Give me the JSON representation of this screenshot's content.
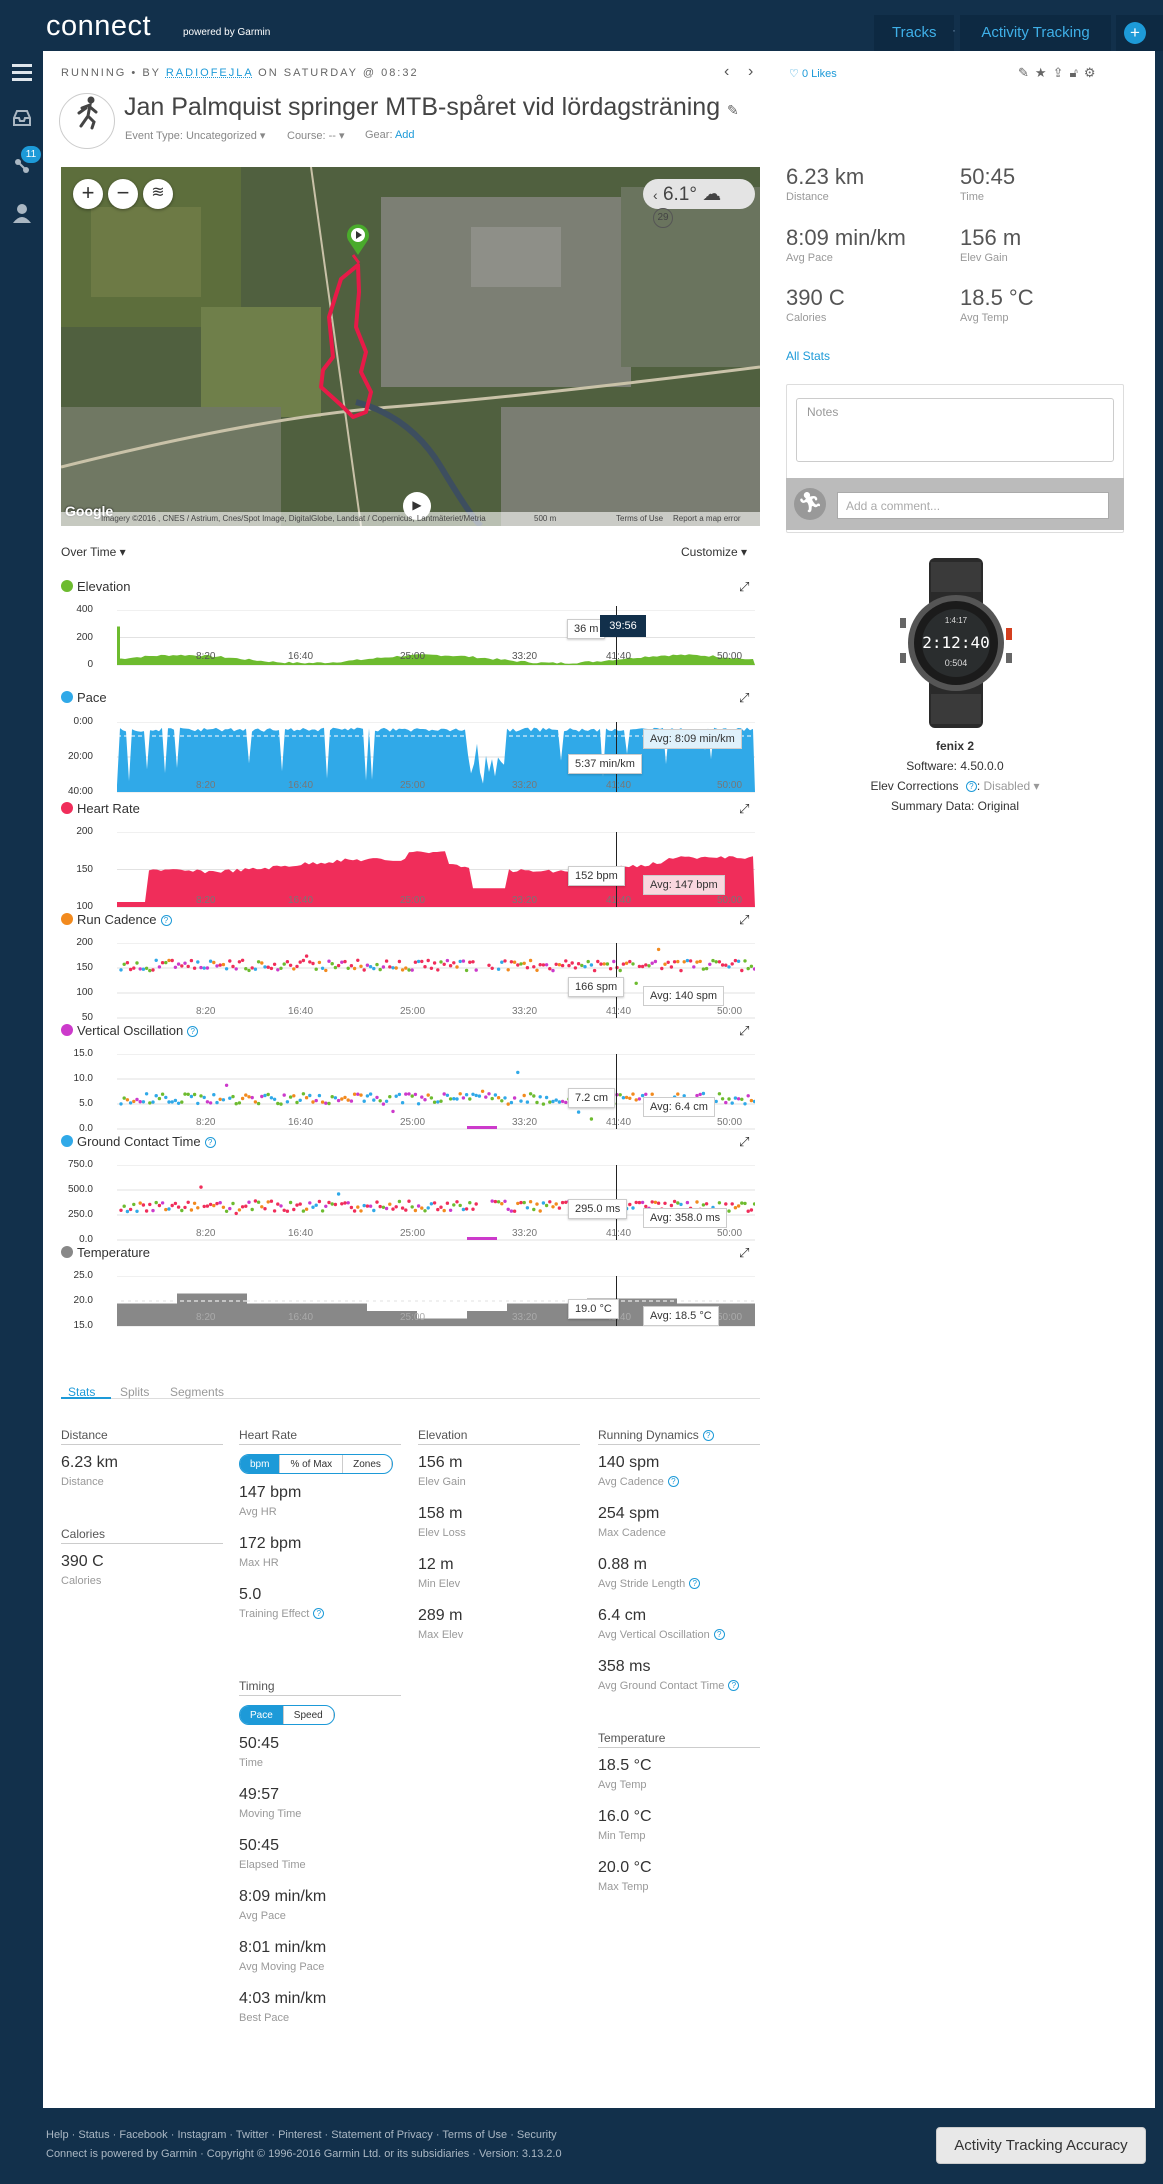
{
  "brand": {
    "logo": "connect",
    "sub": "powered by Garmin"
  },
  "topnav": {
    "tracks": "Tracks",
    "activity_tracking": "Activity Tracking",
    "plus": "+"
  },
  "sidebar": {
    "badge": "11"
  },
  "crumb": {
    "type": "RUNNING",
    "by": "BY",
    "user": "RADIOFEJLA",
    "on": "ON SATURDAY @ 08:32"
  },
  "likes": "0 Likes",
  "title": "Jan Palmquist springer MTB-spåret vid lördagsträning",
  "event": {
    "event_type": "Event Type: Uncategorized ▾",
    "course": "Course: -- ▾",
    "gear_label": "Gear:",
    "gear_add": "Add"
  },
  "map": {
    "temp": "6.1°",
    "wind": "29",
    "attribution": "Imagery ©2016 , CNES / Astrium, Cnes/Spot Image, DigitalGlobe, Landsat / Copernicus, Lantmäteriet/Metria",
    "scale": "500 m",
    "terms": "Terms of Use",
    "report": "Report a map error",
    "google": "Google"
  },
  "summary": [
    {
      "value": "6.23 km",
      "label": "Distance"
    },
    {
      "value": "50:45",
      "label": "Time"
    },
    {
      "value": "8:09 min/km",
      "label": "Avg Pace"
    },
    {
      "value": "156 m",
      "label": "Elev Gain"
    },
    {
      "value": "390 C",
      "label": "Calories"
    },
    {
      "value": "18.5 °C",
      "label": "Avg Temp"
    }
  ],
  "all_stats": "All Stats",
  "notes_placeholder": "Notes",
  "comment_placeholder": "Add a comment...",
  "device": {
    "name": "fenix 2",
    "software": "Software: 4.50.0.0",
    "elev_label": "Elev Corrections",
    "elev_value": "Disabled ▾",
    "summary": "Summary Data: Original",
    "face_time": "2:12:40",
    "face_top": "1:4:17",
    "face_bottom": "0:504"
  },
  "controls": {
    "over_time": "Over Time ▾",
    "customize": "Customize ▾"
  },
  "charts": {
    "cursor_time": "39:56",
    "x_ticks": [
      "8:20",
      "16:40",
      "25:00",
      "33:20",
      "41:40",
      "50:00"
    ],
    "elevation": {
      "title": "Elevation",
      "color": "#6dbb2f",
      "y": [
        "400",
        "200",
        "0"
      ],
      "callout": "36 m"
    },
    "pace": {
      "title": "Pace",
      "color": "#30a9e8",
      "y": [
        "0:00",
        "20:00",
        "40:00"
      ],
      "callout": "5:37 min/km",
      "avg": "Avg: 8:09 min/km"
    },
    "heart": {
      "title": "Heart Rate",
      "color": "#f02d5a",
      "y": [
        "200",
        "150",
        "100"
      ],
      "callout": "152 bpm",
      "avg": "Avg: 147 bpm"
    },
    "cadence": {
      "title": "Run Cadence",
      "color": "#f28a1e",
      "y": [
        "200",
        "150",
        "100",
        "50"
      ],
      "callout": "166 spm",
      "avg": "Avg: 140 spm"
    },
    "vo": {
      "title": "Vertical Oscillation",
      "color": "#cc3acb",
      "y": [
        "15.0",
        "10.0",
        "5.0",
        "0.0"
      ],
      "callout": "7.2 cm",
      "avg": "Avg: 6.4 cm"
    },
    "gct": {
      "title": "Ground Contact Time",
      "color": "#30a9e8",
      "y": [
        "750.0",
        "500.0",
        "250.0",
        "0.0"
      ],
      "callout": "295.0 ms",
      "avg": "Avg: 358.0 ms"
    },
    "temp": {
      "title": "Temperature",
      "color": "#888888",
      "y": [
        "25.0",
        "20.0",
        "15.0"
      ],
      "callout": "19.0 °C",
      "avg": "Avg: 18.5 °C"
    }
  },
  "tabs": [
    "Stats",
    "Splits",
    "Segments"
  ],
  "stats": {
    "distance": {
      "title": "Distance",
      "items": [
        {
          "v": "6.23 km",
          "l": "Distance"
        }
      ]
    },
    "calories": {
      "title": "Calories",
      "items": [
        {
          "v": "390 C",
          "l": "Calories"
        }
      ]
    },
    "heart": {
      "title": "Heart Rate",
      "toggle": [
        "bpm",
        "% of Max",
        "Zones"
      ],
      "items": [
        {
          "v": "147 bpm",
          "l": "Avg HR"
        },
        {
          "v": "172 bpm",
          "l": "Max HR"
        },
        {
          "v": "5.0",
          "l": "Training Effect"
        }
      ]
    },
    "timing": {
      "title": "Timing",
      "toggle": [
        "Pace",
        "Speed"
      ],
      "items": [
        {
          "v": "50:45",
          "l": "Time"
        },
        {
          "v": "49:57",
          "l": "Moving Time"
        },
        {
          "v": "50:45",
          "l": "Elapsed Time"
        },
        {
          "v": "8:09 min/km",
          "l": "Avg Pace"
        },
        {
          "v": "8:01 min/km",
          "l": "Avg Moving Pace"
        },
        {
          "v": "4:03 min/km",
          "l": "Best Pace"
        }
      ]
    },
    "elevation": {
      "title": "Elevation",
      "items": [
        {
          "v": "156 m",
          "l": "Elev Gain"
        },
        {
          "v": "158 m",
          "l": "Elev Loss"
        },
        {
          "v": "12 m",
          "l": "Min Elev"
        },
        {
          "v": "289 m",
          "l": "Max Elev"
        }
      ]
    },
    "dynamics": {
      "title": "Running Dynamics",
      "items": [
        {
          "v": "140 spm",
          "l": "Avg Cadence"
        },
        {
          "v": "254 spm",
          "l": "Max Cadence"
        },
        {
          "v": "0.88 m",
          "l": "Avg Stride Length"
        },
        {
          "v": "6.4 cm",
          "l": "Avg Vertical Oscillation"
        },
        {
          "v": "358 ms",
          "l": "Avg Ground Contact Time"
        }
      ]
    },
    "temperature": {
      "title": "Temperature",
      "items": [
        {
          "v": "18.5 °C",
          "l": "Avg Temp"
        },
        {
          "v": "16.0 °C",
          "l": "Min Temp"
        },
        {
          "v": "20.0 °C",
          "l": "Max Temp"
        }
      ]
    }
  },
  "footer": {
    "line1": "Help · Status · Facebook · Instagram · Twitter · Pinterest · Statement of Privacy · Terms of Use · Security",
    "line2": "Connect is powered by Garmin · Copyright © 1996-2016 Garmin Ltd. or its subsidiaries · Version: 3.13.2.0"
  },
  "accuracy_button": "Activity Tracking Accuracy"
}
